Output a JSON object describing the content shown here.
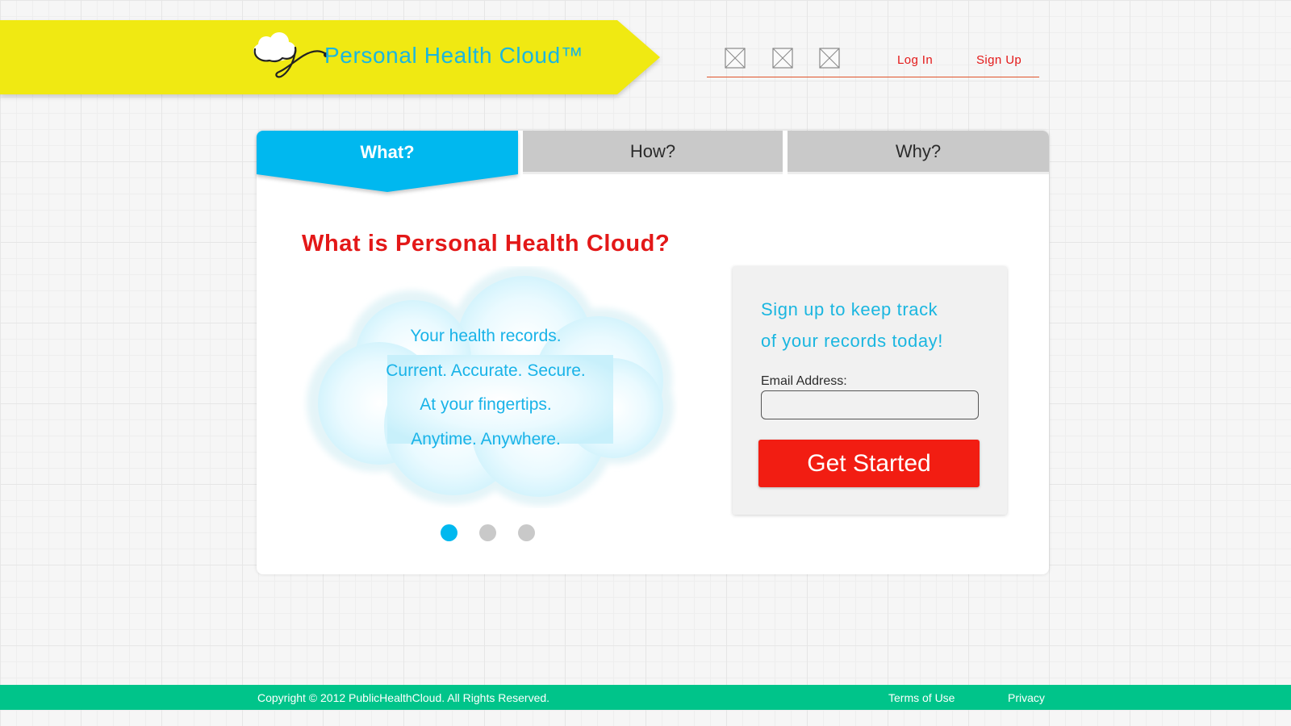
{
  "brand": {
    "name": "Personal Health Cloud™"
  },
  "topnav": {
    "social_icons": [
      "broken-image-icon",
      "broken-image-icon",
      "broken-image-icon"
    ],
    "login_label": "Log In",
    "signup_label": "Sign Up"
  },
  "tabs": [
    {
      "label": "What?",
      "active": true
    },
    {
      "label": "How?",
      "active": false
    },
    {
      "label": "Why?",
      "active": false
    }
  ],
  "main": {
    "heading": "What is Personal Health Cloud?",
    "cloud_lines": [
      "Your health records.",
      "Current. Accurate. Secure.",
      "At your fingertips.",
      "Anytime. Anywhere."
    ],
    "carousel": {
      "total": 3,
      "active_index": 0
    }
  },
  "signup": {
    "heading_line1": "Sign up to keep track",
    "heading_line2": "of your records today!",
    "email_label": "Email Address:",
    "email_value": "",
    "button_label": "Get Started"
  },
  "footer": {
    "copyright": "Copyright © 2012 PublicHealthCloud. All Rights Reserved.",
    "terms_label": "Terms of Use",
    "privacy_label": "Privacy"
  },
  "colors": {
    "banner": "#f0e912",
    "accent_blue": "#00b8ef",
    "accent_red": "#f21d12",
    "footer_green": "#00c48a",
    "tab_inactive": "#c9c9c9"
  }
}
